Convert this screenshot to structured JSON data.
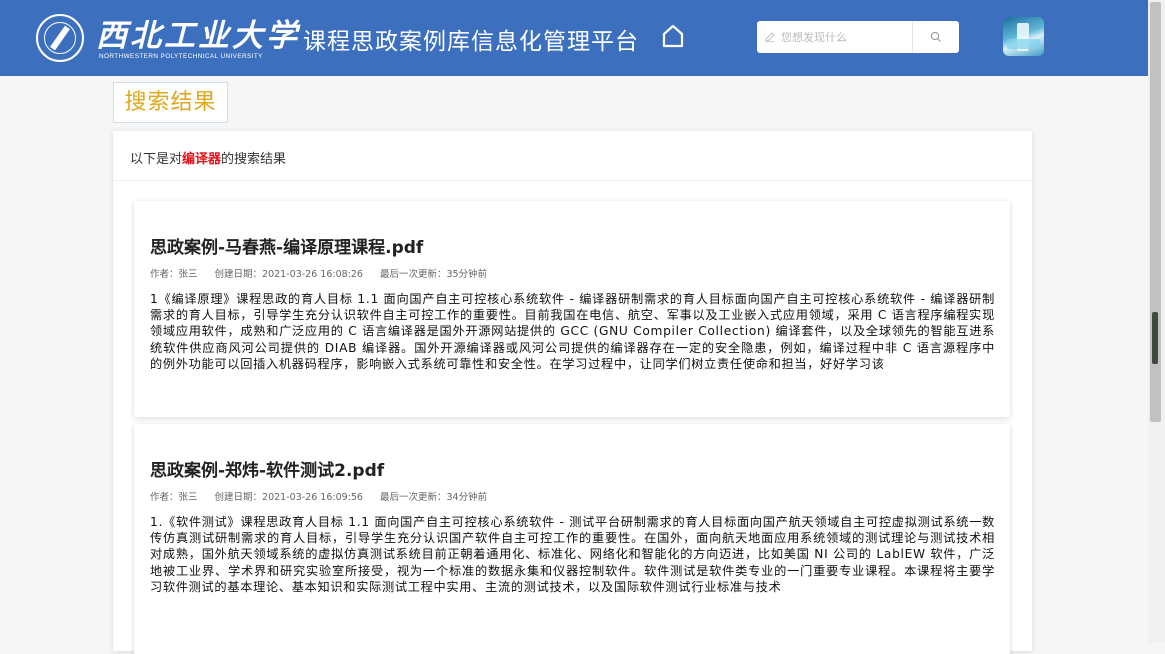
{
  "header": {
    "logo_text": "西北工业大学",
    "logo_subtext": "NORTHWESTERN POLYTECHNICAL UNIVERSITY",
    "platform_title": "课程思政案例库信息化管理平台",
    "home_icon": "home-icon",
    "search_placeholder": "您想发现什么",
    "search_icon": "search-icon",
    "pen_icon": "pen-icon",
    "brand_color": "#3d6fbf"
  },
  "section_title": "搜索结果",
  "result_head": {
    "prefix": "以下是对",
    "keyword": "编译器",
    "suffix": "的搜索结果",
    "keyword_color": "#e8121b"
  },
  "results": [
    {
      "title": "思政案例-马春燕-编译原理课程.pdf",
      "author": "作者：张三",
      "created": "创建日期：2021-03-26 16:08:26",
      "updated": "最后一次更新：35分钟前",
      "body": "1《编译原理》课程思政的育人目标 1.1 面向国产自主可控核心系统软件 - 编译器研制需求的育人目标面向国产自主可控核心系统软件 - 编译器研制需求的育人目标，引导学生充分认识软件自主可控工作的重要性。目前我国在电信、航空、军事以及工业嵌入式应用领域，采用 C 语言程序编程实现领域应用软件，成熟和广泛应用的 C 语言编译器是国外开源网站提供的 GCC (GNU Compiler Collection) 编译套件，以及全球领先的智能互进系统软件供应商风河公司提供的 DIAB 编译器。国外开源编译器或风河公司提供的编译器存在一定的安全隐患，例如，编译过程中非 C 语言源程序中的例外功能可以回插入机器码程序，影响嵌入式系统可靠性和安全性。在学习过程中，让同学们树立责任使命和担当，好好学习该"
    },
    {
      "title": "思政案例-郑炜-软件测试2.pdf",
      "author": "作者：张三",
      "created": "创建日期：2021-03-26 16:09:56",
      "updated": "最后一次更新：34分钟前",
      "body": "1.《软件测试》课程思政育人目标 1.1 面向国产自主可控核心系统软件 - 测试平台研制需求的育人目标面向国产航天领域自主可控虚拟测试系统一数传仿真测试研制需求的育人目标，引导学生充分认识国产软件自主可控工作的重要性。在国外，面向航天地面应用系统领域的测试理论与测试技术相对成熟，国外航天领域系统的虚拟仿真测试系统目前正朝着通用化、标准化、网络化和智能化的方向迈进，比如美国 NI 公司的 LablEW 软件，广泛地被工业界、学术界和研究实验室所接受，视为一个标准的数据永集和仪器控制软件。软件测试是软件类专业的一门重要专业课程。本课程将主要学习软件测试的基本理论、基本知识和实际测试工程中实用、主流的测试技术，以及国际软件测试行业标准与技术"
    }
  ]
}
